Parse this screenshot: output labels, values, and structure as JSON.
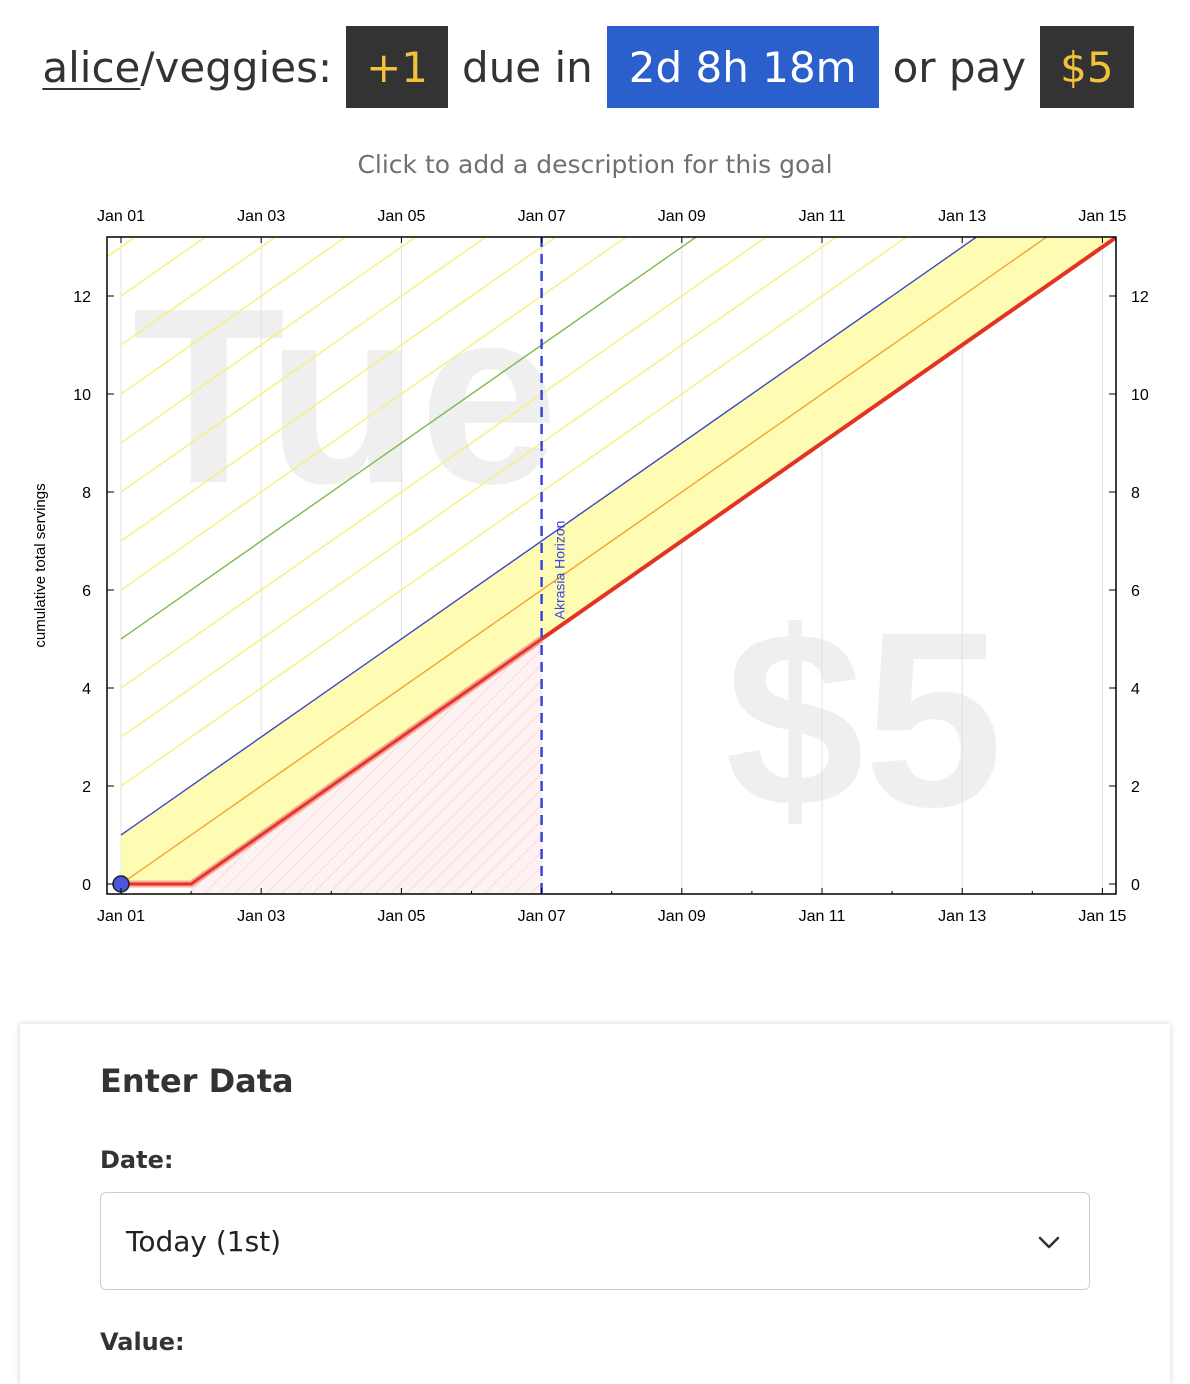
{
  "header": {
    "user": "alice",
    "goal": "/veggies:",
    "delta": "+1",
    "due_text": "due in",
    "countdown": "2d 8h 18m",
    "pay_text": "or pay",
    "pledge": "$5"
  },
  "description_placeholder": "Click to add a description for this goal",
  "chart_data": {
    "type": "line",
    "x_tick_labels": [
      "Jan 01",
      "Jan 03",
      "Jan 05",
      "Jan 07",
      "Jan 09",
      "Jan 11",
      "Jan 13",
      "Jan 15"
    ],
    "x_range_days": [
      1,
      15.2
    ],
    "y_ticks": [
      0,
      2,
      4,
      6,
      8,
      10,
      12
    ],
    "ylim": [
      -0.2,
      13.2
    ],
    "ylabel": "cumulative total servings",
    "watermark_day": "Tue",
    "watermark_pledge": "$5",
    "horizon_label": "Akrasia Horizon",
    "horizon_day": 7,
    "series": [
      {
        "role": "bright-red-line",
        "color": "#e53323",
        "points": [
          [
            1,
            0
          ],
          [
            2,
            0
          ],
          [
            15.2,
            13.2
          ]
        ]
      },
      {
        "role": "orange-line",
        "color": "#f5a134",
        "points": [
          [
            1,
            0
          ],
          [
            14.2,
            13.2
          ]
        ]
      },
      {
        "role": "blue-line",
        "color": "#3f48c5",
        "points": [
          [
            1,
            1
          ],
          [
            13.2,
            13.2
          ]
        ]
      },
      {
        "role": "green-line",
        "color": "#7dbb42",
        "points": [
          [
            1,
            5
          ],
          [
            9.2,
            13.2
          ]
        ]
      }
    ],
    "datapoints": [
      {
        "x": 1,
        "y": 0,
        "color": "#4a55e0"
      }
    ],
    "grid": true
  },
  "enter_data": {
    "title": "Enter Data",
    "date_label": "Date:",
    "date_value": "Today (1st)",
    "value_label": "Value:"
  }
}
